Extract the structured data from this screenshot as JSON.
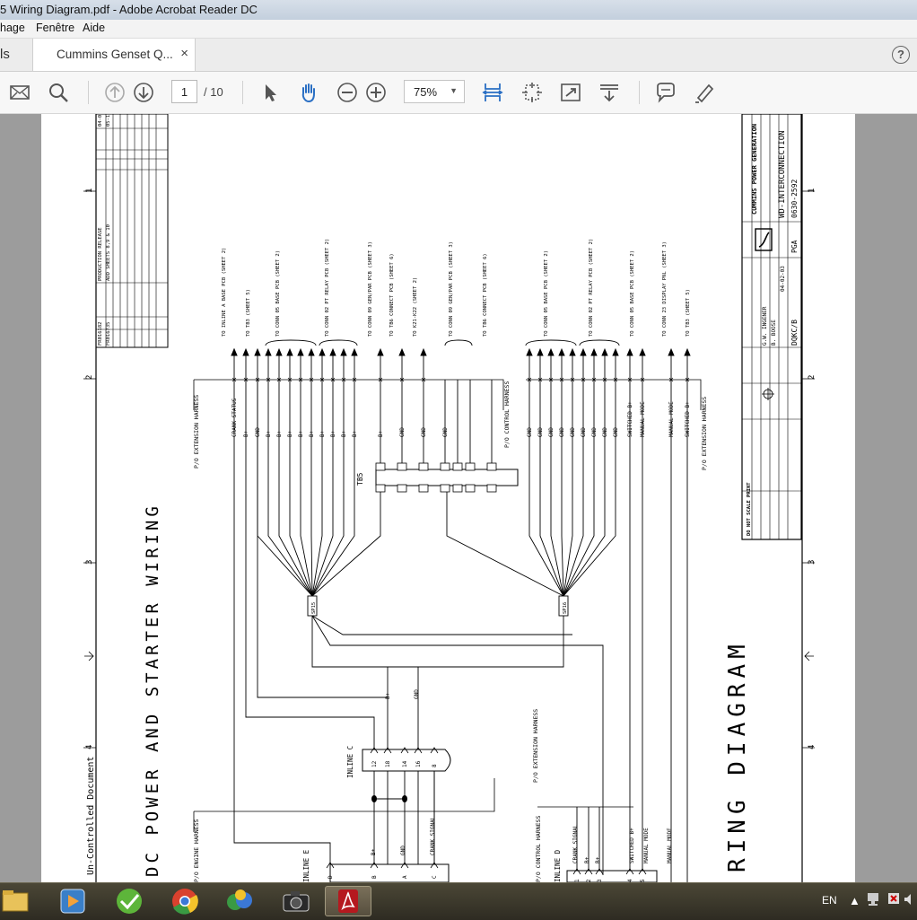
{
  "window": {
    "title": "5 Wiring Diagram.pdf - Adobe Acrobat Reader DC"
  },
  "menu": {
    "items": [
      "hage",
      "Fenêtre",
      "Aide"
    ]
  },
  "tabs": {
    "tools_label": "ls",
    "document_label": "Cummins Genset Q...",
    "close_glyph": "×",
    "help_glyph": "?"
  },
  "toolbar": {
    "icons": [
      "mail-icon",
      "search-icon",
      "page-up-icon",
      "page-down-icon",
      "select-cursor-icon",
      "hand-icon",
      "zoom-out-icon",
      "zoom-in-icon",
      "fit-width-icon",
      "fit-page-icon",
      "fullscreen-icon",
      "scroll-mode-icon",
      "comment-icon",
      "highlight-icon"
    ],
    "page_current": "1",
    "page_total": "/ 10",
    "zoom": "75%"
  },
  "drawing": {
    "title": "DC POWER AND STARTER WIRING",
    "big_title": "RING DIAGRAM",
    "uncontrolled": "Un-Controlled Document",
    "tb5": "TB5",
    "inline_c": "INLINE C",
    "inline_e": "INLINE E",
    "inline_d": "INLINE D",
    "sp15": "SP15",
    "sp16": "SP16",
    "border_numbers": [
      "1",
      "2",
      "3",
      "4"
    ],
    "left_group_targets": [
      "TO INLINE A BASE PCB (SHEET 2)",
      "TO TB3 (SHEET 5)",
      "TO CONN 05 BASE PCB (SHEET 2)",
      "TO CONN 02 PT RELAY PCB (SHEET 2)",
      "TO CONN 09 GEN/PAR PCB (SHEET 3)",
      "TO TB6 CONNECT PCB (SHEET 6)",
      "TO K21-K22 (SHEET 2)",
      "TO CONN 09 GEN/PAR PCB (SHEET 3)",
      "TO TB6 CONNECT PCB (SHEET 6)"
    ],
    "right_group_targets": [
      "TO CONN 05 BASE PCB (SHEET 2)",
      "TO CONN 02 PT RELAY PCB (SHEET 2)",
      "TO CONN 05 BASE PCB (SHEET 2)",
      "TO CONN 23 DISPLAY PNL (SHEET 3)",
      "TO TB3 (SHEET 5)"
    ],
    "left_wire_labels": [
      "CRANK STATUS",
      "B+",
      "GND",
      "B+",
      "B+",
      "B+",
      "B+",
      "B+",
      "B+",
      "B+",
      "B+",
      "B+",
      "B+",
      "GND",
      "GND",
      "GND"
    ],
    "right_wire_labels": [
      "GND",
      "GND",
      "GND",
      "GND",
      "GND",
      "GND",
      "GND",
      "GND",
      "GND",
      "SWITCHED B+",
      "MANUAL MODE",
      "MANUAL MODE",
      "SWITCHED B+"
    ],
    "harness_labels": [
      "P/O EXTENSION HARNESS",
      "P/O CONTROL HARNESS",
      "P/O EXTENSION HARNESS",
      "P/O EXTENSION HARNESS",
      "P/O ENGINE HARNESS",
      "P/O CONTROL HARNESS"
    ],
    "inline_c_pins": [
      "12",
      "18",
      "14",
      "16",
      "8"
    ],
    "inline_c_wire_labels": [
      "B+",
      "GND"
    ],
    "inline_e_pins": [
      "D",
      "B",
      "A",
      "C"
    ],
    "inline_e_wire_labels": [
      "B+",
      "GND",
      "CRANK SIGNAL"
    ],
    "inline_d_pins": [
      "1",
      "2",
      "3",
      "4",
      "5"
    ],
    "inline_d_wire_labels": [
      "CRANK SIGNAL",
      "B+",
      "B+",
      "SWITCHED B+",
      "MANUAL MODE",
      "MANUAL MODE"
    ],
    "title_block": {
      "company": "CUMMINS POWER GENERATION",
      "drawing_title": "WD-INTERCONNECTION",
      "drawing_number": "0630-2592",
      "pga": "PGA",
      "sheet_ref": "DQKC/B",
      "engineer": "G.W. INGENER",
      "approved": "B. BOOSE",
      "date": "04-02-03",
      "scale": "DO NOT SCALE PRINT"
    },
    "revision_block": {
      "rows": [
        [
          "FR016182",
          "A",
          "I",
          "PRODUCTION RELEASE",
          "GBH",
          "BB",
          "BOOSE",
          "04-02"
        ],
        [
          "FR016735",
          "B",
          "I",
          "ADD SHEETS 8,9 & 10",
          "ASN",
          "BB",
          "BB",
          "05-18"
        ]
      ]
    }
  },
  "taskbar": {
    "apps": [
      "explorer-icon",
      "media-player-icon",
      "greenshot-icon",
      "chrome-icon",
      "messenger-icon",
      "camera-icon",
      "acrobat-icon"
    ],
    "language": "EN"
  }
}
